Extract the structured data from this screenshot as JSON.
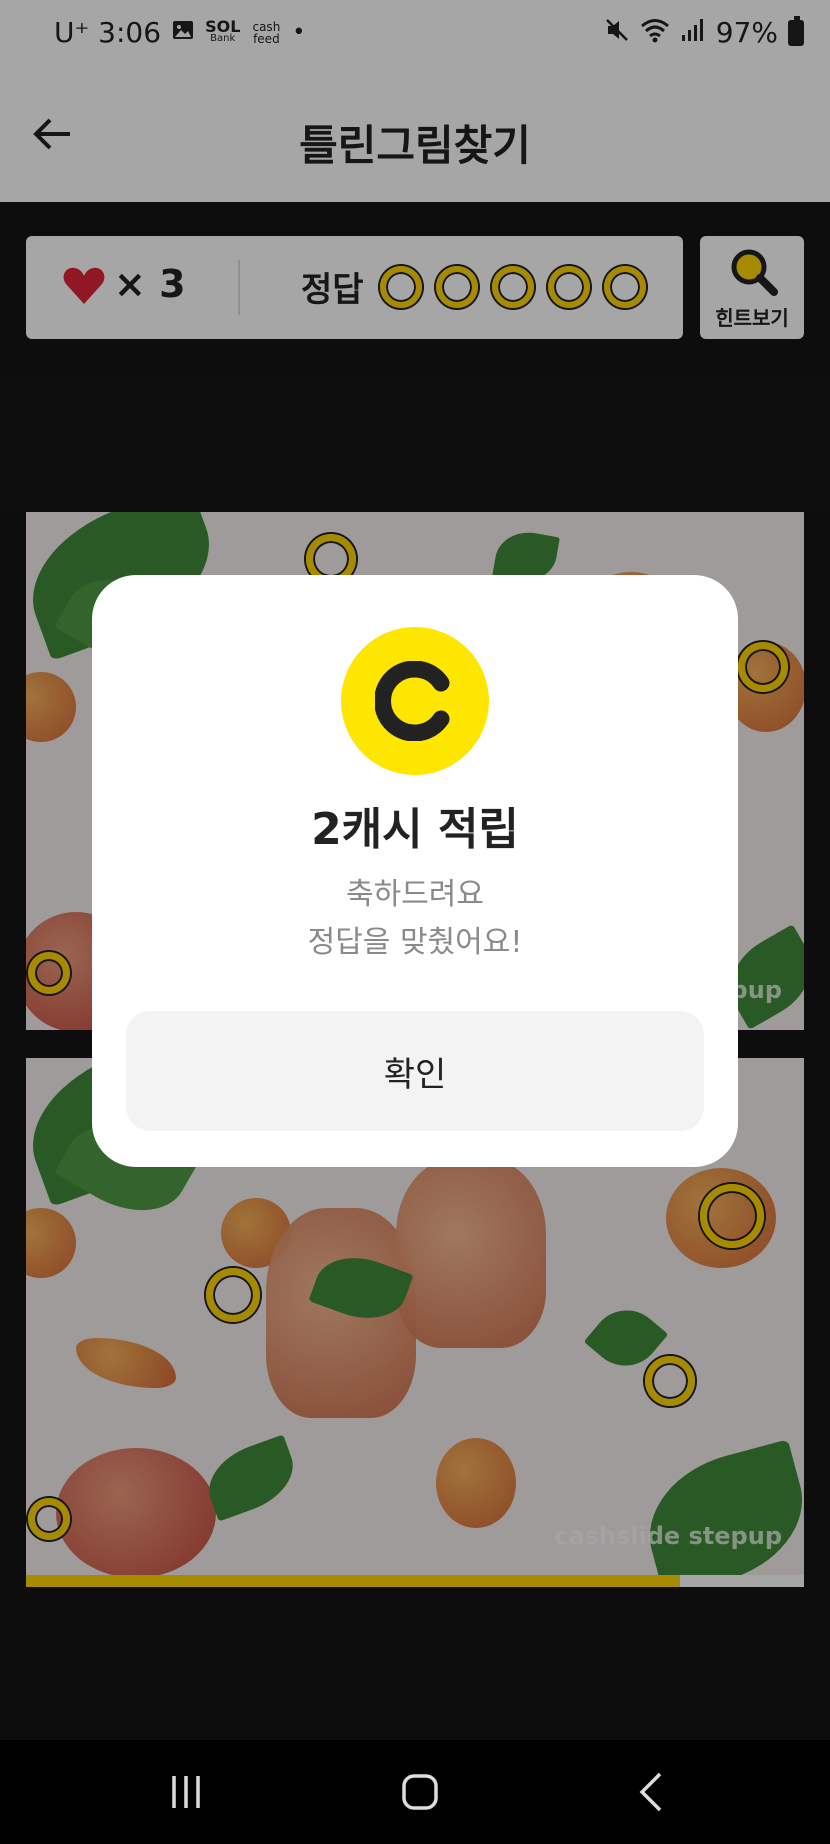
{
  "status_bar": {
    "carrier_time": "U⁺ 3:06",
    "notification_icons": [
      "image-icon",
      "sol-bank-icon",
      "cash-feed-icon"
    ],
    "sol_label": "SOL",
    "sol_sub": "Bank",
    "cash_feed_label": "cash feed",
    "dot": "•",
    "battery": "97%"
  },
  "header": {
    "title": "틀린그림찾기"
  },
  "score": {
    "lives": "× 3",
    "answer_label": "정답",
    "answer_slots": 5
  },
  "hint": {
    "label": "힌트보기"
  },
  "picture": {
    "watermark": "cashslide stepup"
  },
  "progress": {
    "fraction": 0.84
  },
  "modal": {
    "coin_letter": "C",
    "reward": "2캐시 적립",
    "message_line1": "축하드려요",
    "message_line2": "정답을 맞췄어요!",
    "confirm_label": "확인"
  },
  "colors": {
    "accent": "#ffd400",
    "coin": "#ffe600",
    "heart": "#e0243a",
    "background": "#151515"
  }
}
